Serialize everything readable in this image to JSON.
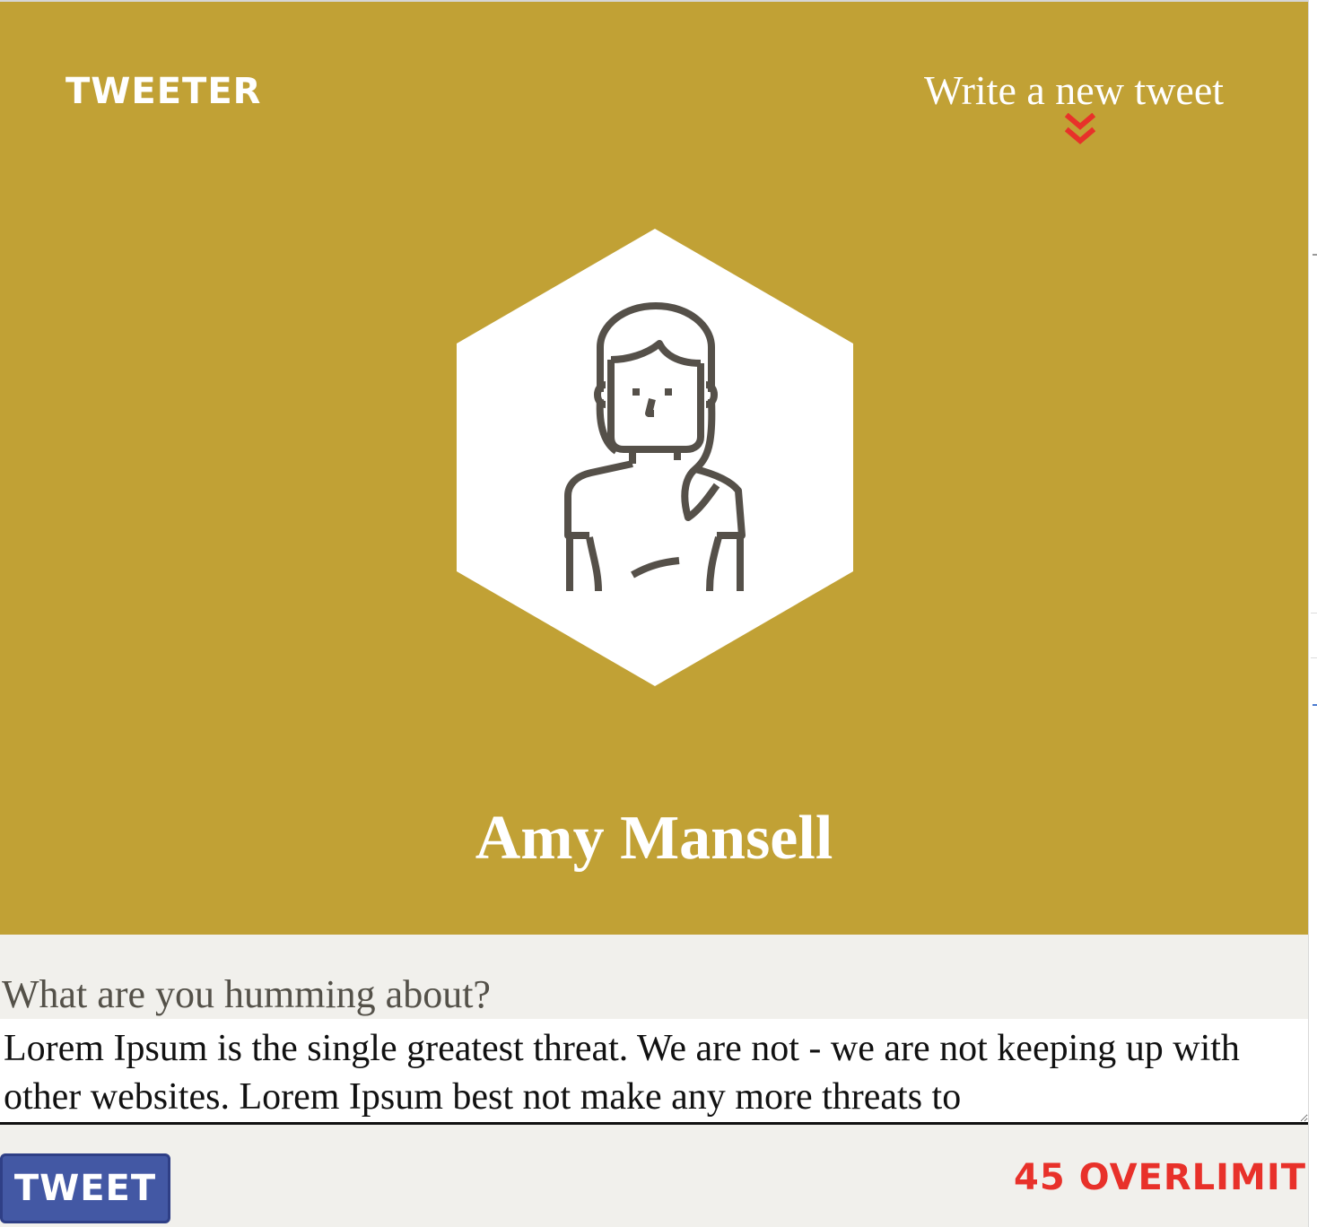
{
  "header": {
    "brand": "TWEETER",
    "compose_link": "Write a new tweet",
    "compose_icon": "double-chevron-down-icon"
  },
  "profile": {
    "avatar_icon": "woman-avatar-icon",
    "name": "Amy Mansell"
  },
  "composer": {
    "prompt": "What are you humming about?",
    "text": "Lorem Ipsum is the single greatest threat. We are not - we are not keeping up with other websites. Lorem Ipsum best not make any more threats to",
    "button_label": "TWEET",
    "counter": "45 OVERLIMIT"
  },
  "colors": {
    "banner": "#c1a135",
    "page_background": "#f1f0ec",
    "button": "#4358a4",
    "counter_over_limit": "#e8312a",
    "chevron": "#e8312a",
    "avatar_stroke": "#555049"
  }
}
